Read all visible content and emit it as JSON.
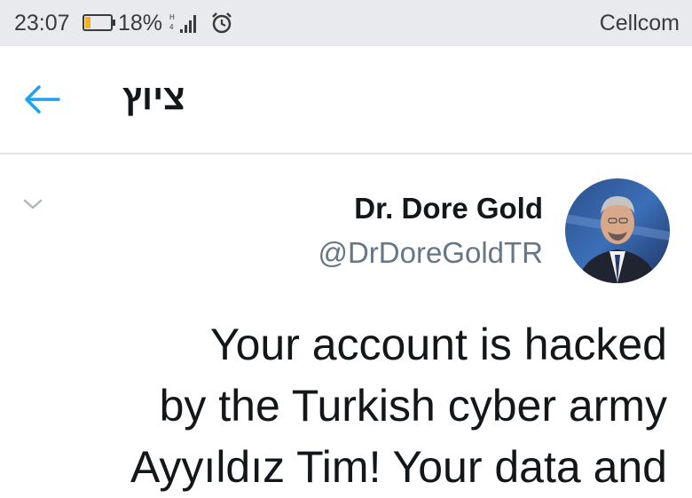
{
  "status_bar": {
    "time": "23:07",
    "battery_percent": "18%",
    "carrier": "Cellcom",
    "icons": [
      "battery-icon",
      "signal-icon",
      "alarm-icon"
    ]
  },
  "header": {
    "back_icon": "arrow-left-icon",
    "title": "ציוץ"
  },
  "tweet": {
    "author_name": "Dr. Dore Gold",
    "author_handle": "@DrDoreGoldTR",
    "text": "Your account is hacked\nby the Turkish cyber army\nAyyıldız Tim! Your data and",
    "menu_icon": "chevron-down-icon"
  },
  "colors": {
    "accent": "#1da1f2",
    "status_bar_bg": "#e9eaed",
    "handle_gray": "#657786",
    "text": "#14171a"
  }
}
